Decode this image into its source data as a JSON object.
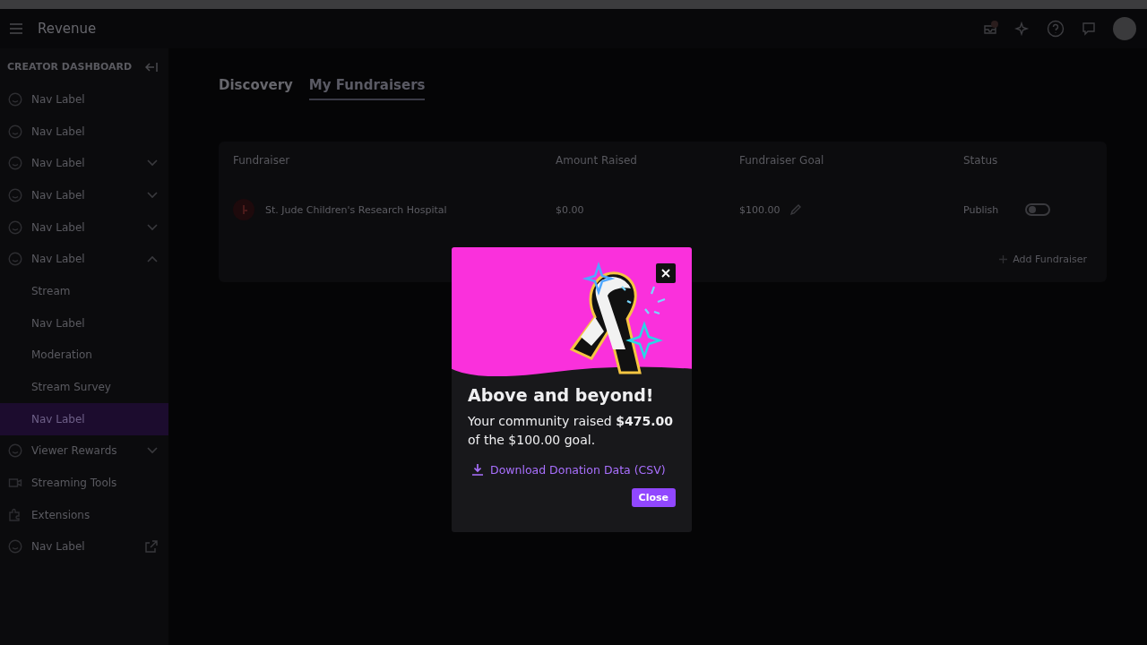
{
  "top_bar": {
    "title": "Revenue"
  },
  "sidebar": {
    "heading": "CREATOR DASHBOARD",
    "items": [
      {
        "label": "Nav Label",
        "kind": "link",
        "selected": false
      },
      {
        "label": "Nav Label",
        "kind": "link",
        "selected": false
      },
      {
        "label": "Nav Label",
        "kind": "group",
        "expanded": false,
        "selected": false
      },
      {
        "label": "Nav Label",
        "kind": "group",
        "expanded": false,
        "selected": false
      },
      {
        "label": "Nav Label",
        "kind": "group",
        "expanded": false,
        "selected": false
      },
      {
        "label": "Nav Label",
        "kind": "group",
        "expanded": true,
        "selected": false,
        "children": [
          {
            "label": "Stream",
            "selected": false
          },
          {
            "label": "Nav Label",
            "selected": false
          },
          {
            "label": "Moderation",
            "selected": false
          },
          {
            "label": "Stream Survey",
            "selected": false
          },
          {
            "label": "Nav Label",
            "selected": true
          }
        ]
      },
      {
        "label": "Viewer Rewards",
        "kind": "group",
        "expanded": false,
        "selected": false
      },
      {
        "label": "Streaming Tools",
        "kind": "link",
        "selected": false
      },
      {
        "label": "Extensions",
        "kind": "link",
        "selected": false
      },
      {
        "label": "Nav Label",
        "kind": "external",
        "selected": false
      }
    ]
  },
  "tabs": [
    {
      "label": "Discovery",
      "selected": false
    },
    {
      "label": "My Fundraisers",
      "selected": true
    }
  ],
  "table": {
    "columns": [
      "Fundraiser",
      "Amount Raised",
      "Fundraiser Goal",
      "Status"
    ],
    "rows": [
      {
        "fundraiser": "St. Jude Children's Research Hospital",
        "amount": "$0.00",
        "goal": "$100.00",
        "status": "Publish",
        "published": false
      }
    ],
    "add_button": "Add Fundraiser"
  },
  "modal": {
    "title": "Above and beyond!",
    "message": "Your community raised **$475.00** of the $100.00 goal.",
    "download_link": "Download Donation Data (CSV)",
    "close_button": "Close"
  }
}
